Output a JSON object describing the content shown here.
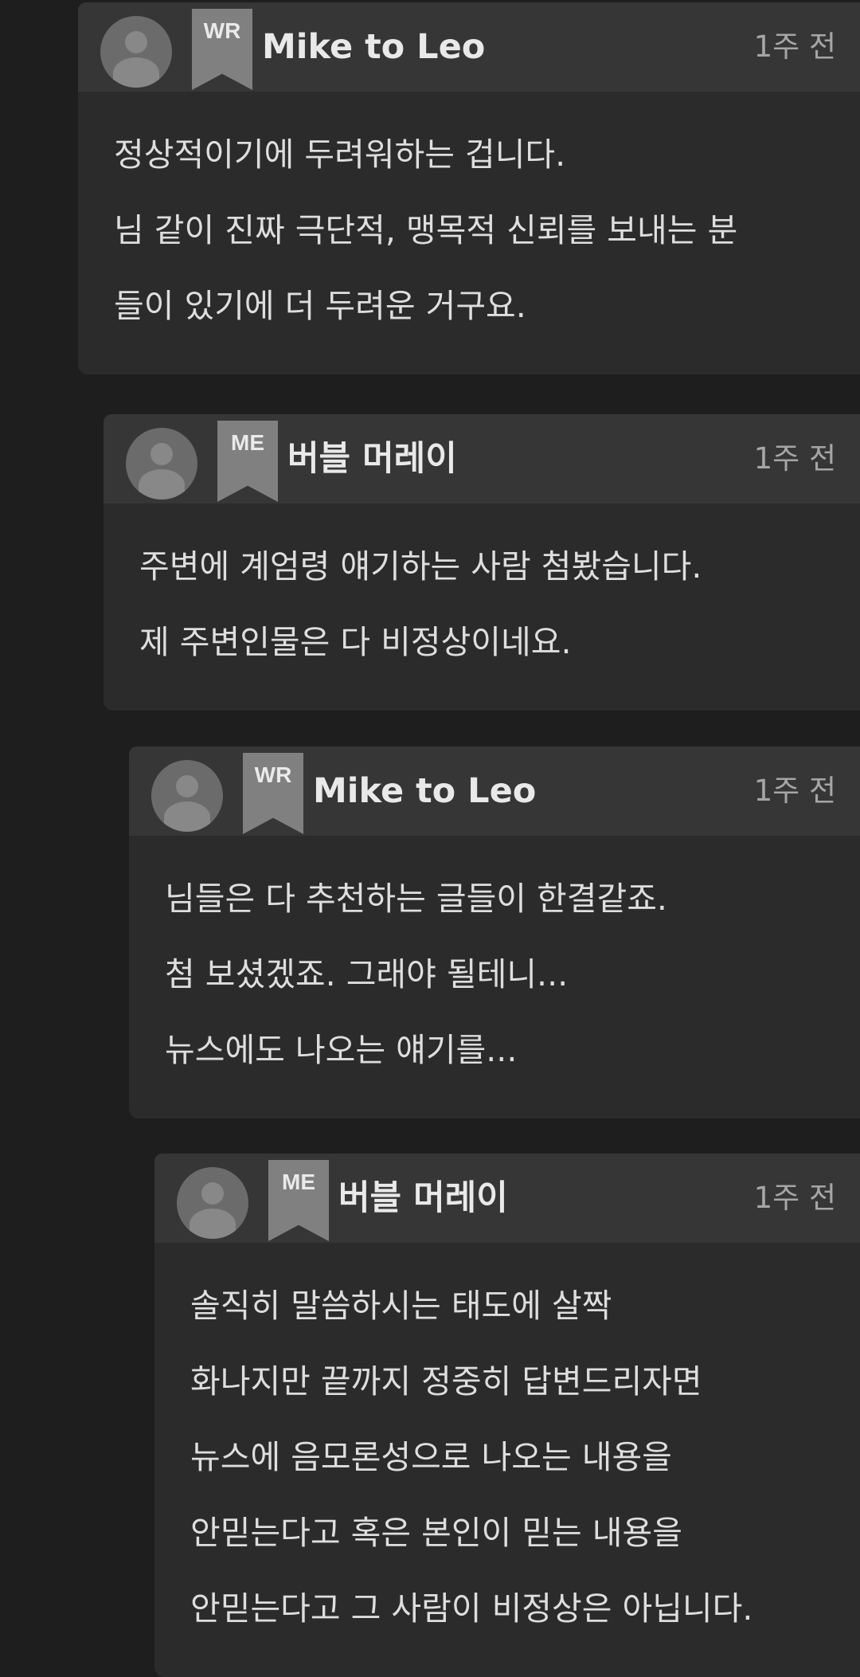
{
  "comments": [
    {
      "badge": "WR",
      "author": "Mike to Leo",
      "time": "1주 전",
      "lines": [
        "정상적이기에 두려워하는 겁니다.",
        "님 같이 진짜 극단적, 맹목적 신뢰를 보내는 분",
        "들이 있기에 더 두려운 거구요."
      ]
    },
    {
      "badge": "ME",
      "author": "버블 머레이",
      "time": "1주 전",
      "lines": [
        "주변에 계엄령 얘기하는 사람 첨봤습니다.",
        "제 주변인물은 다 비정상이네요."
      ]
    },
    {
      "badge": "WR",
      "author": "Mike to Leo",
      "time": "1주 전",
      "lines": [
        "님들은 다 추천하는 글들이 한결같죠.",
        "첨 보셨겠죠. 그래야 될테니...",
        "뉴스에도 나오는 얘기를..."
      ]
    },
    {
      "badge": "ME",
      "author": "버블 머레이",
      "time": "1주 전",
      "lines": [
        "솔직히 말씀하시는 태도에 살짝",
        "화나지만 끝까지 정중히 답변드리자면",
        "뉴스에 음모론성으로 나오는 내용을",
        "안믿는다고 혹은 본인이 믿는 내용을",
        "안믿는다고 그 사람이 비정상은 아닙니다."
      ]
    }
  ]
}
